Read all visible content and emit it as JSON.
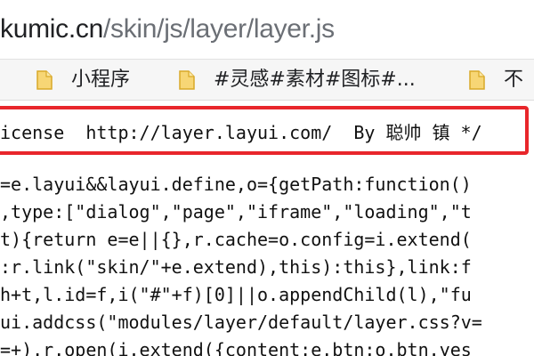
{
  "address_bar": {
    "url_host": "kumic.cn",
    "url_path": "/skin/js/layer/layer.js"
  },
  "bookmarks": [
    {
      "icon": "folder-icon",
      "label": "小程序"
    },
    {
      "icon": "folder-icon",
      "label": "#灵感#素材#图标#..."
    },
    {
      "icon": "folder-icon",
      "label": "不"
    }
  ],
  "source": {
    "lines": [
      "icense  http://layer.layui.com/  By 聪帅 镇 */",
      "=e.layui&&layui.define,o={getPath:function()",
      ",type:[\"dialog\",\"page\",\"iframe\",\"loading\",\"t",
      "t){return e=e||{},r.cache=o.config=i.extend(",
      ":r.link(\"skin/\"+e.extend),this):this},link:f",
      "h+t,l.id=f,i(\"#\"+f)[0]||o.appendChild(l),\"fu",
      "ui.addcss(\"modules/layer/default/layer.css?v=",
      "=+).r.open(i.extend({content:e.btn:o.btn.yes"
    ]
  },
  "colors": {
    "highlight_border": "#e8262b",
    "folder_fill": "#f7d675",
    "folder_stroke": "#d9a928"
  }
}
